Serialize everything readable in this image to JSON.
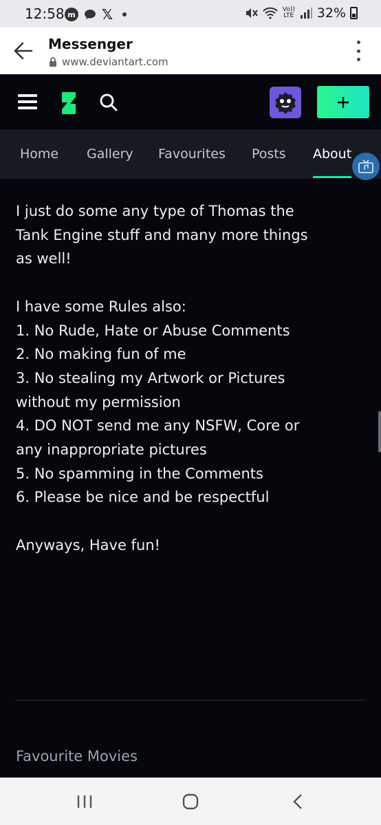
{
  "status_bar": {
    "time": "12:58",
    "battery": "32%",
    "volte_label": "Vo))",
    "lte_label": "LTE",
    "icons": [
      "messenger-icon",
      "chat-icon",
      "x-icon",
      "dot-icon",
      "mute-icon",
      "wifi-icon",
      "signal-icon",
      "battery-icon"
    ]
  },
  "custom_tab": {
    "title": "Messenger",
    "url": "www.deviantart.com"
  },
  "topbar": {
    "create_label": "+"
  },
  "nav": {
    "tabs": [
      {
        "label": "Home"
      },
      {
        "label": "Gallery"
      },
      {
        "label": "Favourites"
      },
      {
        "label": "Posts"
      },
      {
        "label": "About",
        "active": true
      }
    ]
  },
  "about": {
    "intro_lines": [
      "I just do some any type of Thomas the",
      "Tank Engine stuff and many more things",
      "as well!"
    ],
    "rules_lines": [
      "I have some Rules also:",
      "1. No Rude, Hate or Abuse Comments",
      "2. No making fun of me",
      "3. No stealing my Artwork or Pictures",
      "without my permission",
      "4. DO NOT send me any NSFW, Core or",
      "any inappropriate pictures",
      "5. No spamming in the Comments",
      "6. Please be nice and be respectful"
    ],
    "outro": "Anyways, Have fun!"
  },
  "favourite_movies": {
    "title": "Favourite Movies"
  },
  "colors": {
    "accent": "#2cd9a6",
    "create_button": "#2af58e",
    "avatar_bg": "#6c59d9",
    "page_bg": "#06070d",
    "tab_bar_bg": "#171a21"
  }
}
